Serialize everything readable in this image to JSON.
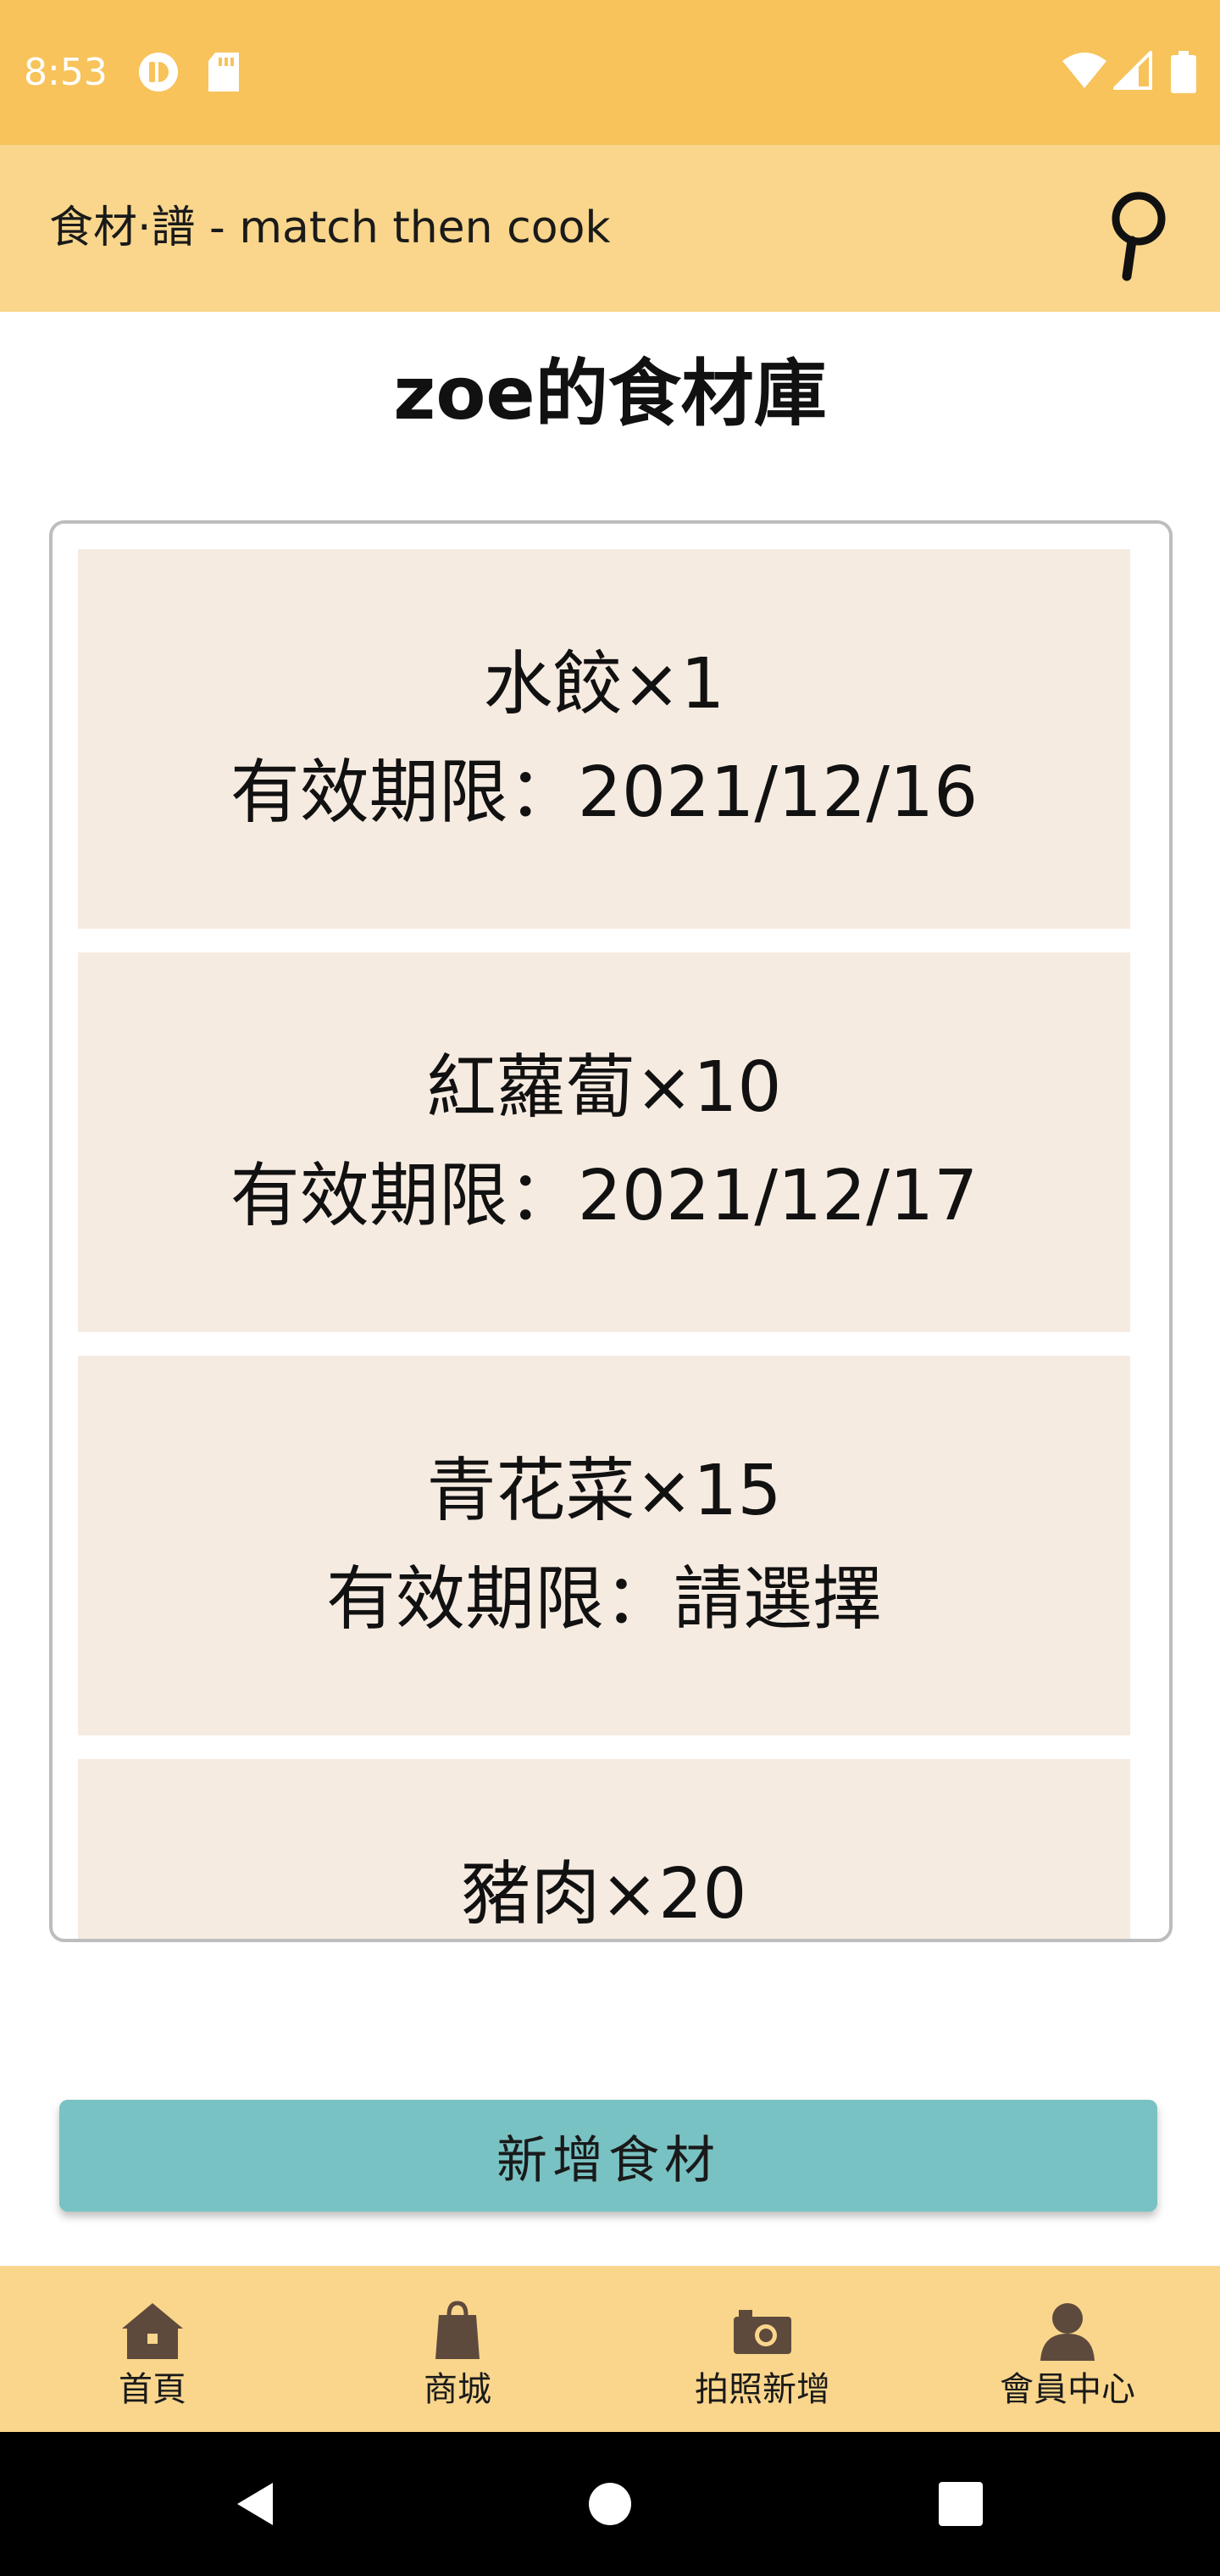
{
  "status_bar": {
    "time": "8:53",
    "icons": [
      "app-notification-icon",
      "sd-card-icon",
      "wifi-icon",
      "cell-signal-icon",
      "battery-icon"
    ]
  },
  "app_bar": {
    "title": "食材·譜 - match then cook",
    "search_icon": "magnifier-icon"
  },
  "page_title": "zoe的食材庫",
  "ingredients": [
    {
      "name": "水餃×1",
      "expiry": "有效期限：2021/12/16"
    },
    {
      "name": "紅蘿蔔×10",
      "expiry": "有效期限：2021/12/17"
    },
    {
      "name": "青花菜×15",
      "expiry": "有效期限：請選擇"
    },
    {
      "name": "豬肉×20"
    }
  ],
  "add_button": "新增食材",
  "bottom_nav": [
    {
      "label": "首頁",
      "icon": "home-icon"
    },
    {
      "label": "商城",
      "icon": "shopping-bag-icon"
    },
    {
      "label": "拍照新增",
      "icon": "camera-icon"
    },
    {
      "label": "會員中心",
      "icon": "user-icon"
    }
  ],
  "colors": {
    "status_bar": "#f7c35a",
    "app_bar": "#f9d68c",
    "card": "#f6ebe1",
    "button": "#79c2c3",
    "nav_icon": "#5e4a3c"
  }
}
